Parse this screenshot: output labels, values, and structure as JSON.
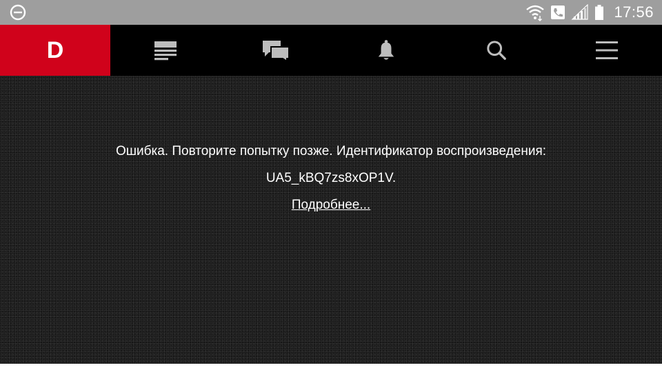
{
  "status_bar": {
    "time": "17:56",
    "icons": [
      "do-not-disturb-icon",
      "wifi-icon",
      "call-icon",
      "signal-icon",
      "battery-icon"
    ]
  },
  "nav": {
    "brand_letter": "D",
    "items": [
      "news-icon",
      "comments-icon",
      "notifications-icon",
      "search-icon",
      "menu-icon"
    ]
  },
  "error": {
    "message": "Ошибка. Повторите попытку позже. Идентификатор воспроизведения:",
    "playback_id": "UA5_kBQ7zs8xOP1V.",
    "more_link": "Подробнее..."
  },
  "colors": {
    "brand_red": "#d0021b",
    "nav_bg": "#000000",
    "status_bg": "#9e9e9e",
    "content_bg": "#1a1a1a"
  }
}
